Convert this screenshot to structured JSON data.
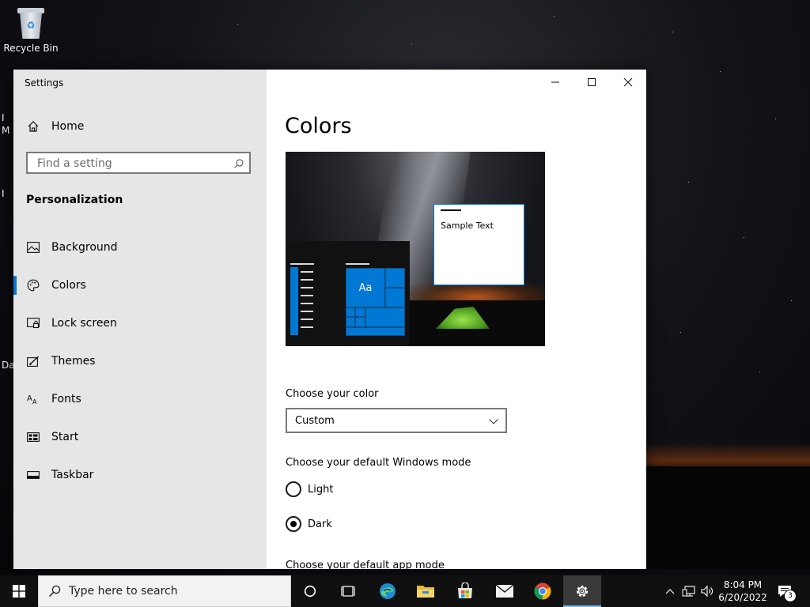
{
  "desktop": {
    "icons": [
      {
        "label": "Recycle Bin",
        "icon": "recycle-bin-icon"
      }
    ],
    "edge_fragments": [
      "I",
      "M",
      "I",
      "Da"
    ]
  },
  "window": {
    "title": "Settings",
    "controls": {
      "minimize": "minimize-icon",
      "maximize": "maximize-icon",
      "close": "close-icon"
    }
  },
  "sidebar": {
    "home_label": "Home",
    "search_placeholder": "Find a setting",
    "section_title": "Personalization",
    "items": [
      {
        "label": "Background",
        "icon": "image-icon"
      },
      {
        "label": "Colors",
        "icon": "palette-icon",
        "selected": true
      },
      {
        "label": "Lock screen",
        "icon": "lock-screen-icon"
      },
      {
        "label": "Themes",
        "icon": "themes-icon"
      },
      {
        "label": "Fonts",
        "icon": "fonts-icon"
      },
      {
        "label": "Start",
        "icon": "start-icon"
      },
      {
        "label": "Taskbar",
        "icon": "taskbar-icon"
      }
    ]
  },
  "main": {
    "title": "Colors",
    "preview": {
      "tile_text": "Aa",
      "sample_text": "Sample Text"
    },
    "choose_color_label": "Choose your color",
    "choose_color_value": "Custom",
    "windows_mode_label": "Choose your default Windows mode",
    "windows_mode_options": [
      {
        "label": "Light",
        "checked": false
      },
      {
        "label": "Dark",
        "checked": true
      }
    ],
    "app_mode_label": "Choose your default app mode"
  },
  "taskbar": {
    "search_placeholder": "Type here to search",
    "apps": [
      "cortana-icon",
      "task-view-icon",
      "edge-icon",
      "file-explorer-icon",
      "store-icon",
      "mail-icon",
      "chrome-icon",
      "settings-icon"
    ],
    "time": "8:04 PM",
    "date": "6/20/2022",
    "notification_count": "3"
  },
  "colors": {
    "accent": "#0078d4",
    "sidebar_bg": "#e6e6e6",
    "taskbar_bg": "#101010"
  }
}
